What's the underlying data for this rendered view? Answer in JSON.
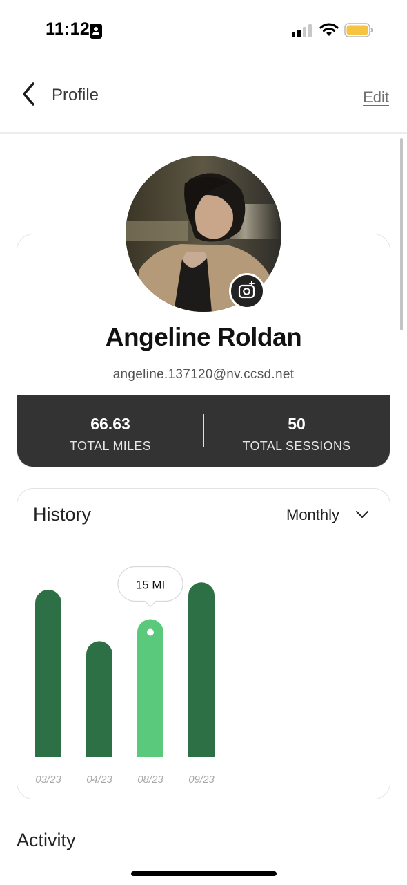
{
  "status_bar": {
    "time": "11:12",
    "signal_bars_active": 2,
    "signal_bars_total": 4,
    "battery_color": "#f5c542"
  },
  "header": {
    "title": "Profile",
    "edit_label": "Edit"
  },
  "profile": {
    "name": "Angeline Roldan",
    "email": "angeline.137120@nv.ccsd.net",
    "stats": [
      {
        "value": "66.63",
        "label": "TOTAL MILES"
      },
      {
        "value": "50",
        "label": "TOTAL SESSIONS"
      }
    ]
  },
  "history": {
    "title": "History",
    "period": "Monthly",
    "tooltip": "15 MI"
  },
  "chart_data": {
    "type": "bar",
    "categories": [
      "03/23",
      "04/23",
      "08/23",
      "09/23"
    ],
    "values": [
      18.2,
      12.6,
      15,
      19
    ],
    "unit": "MI",
    "highlighted_index": 2,
    "colors": {
      "bar": "#2e7046",
      "highlight": "#5bc97b"
    }
  },
  "activity": {
    "title": "Activity"
  },
  "icons": {
    "back": "chevron-left-icon",
    "dropdown": "chevron-down-icon",
    "camera": "camera-add-icon"
  }
}
